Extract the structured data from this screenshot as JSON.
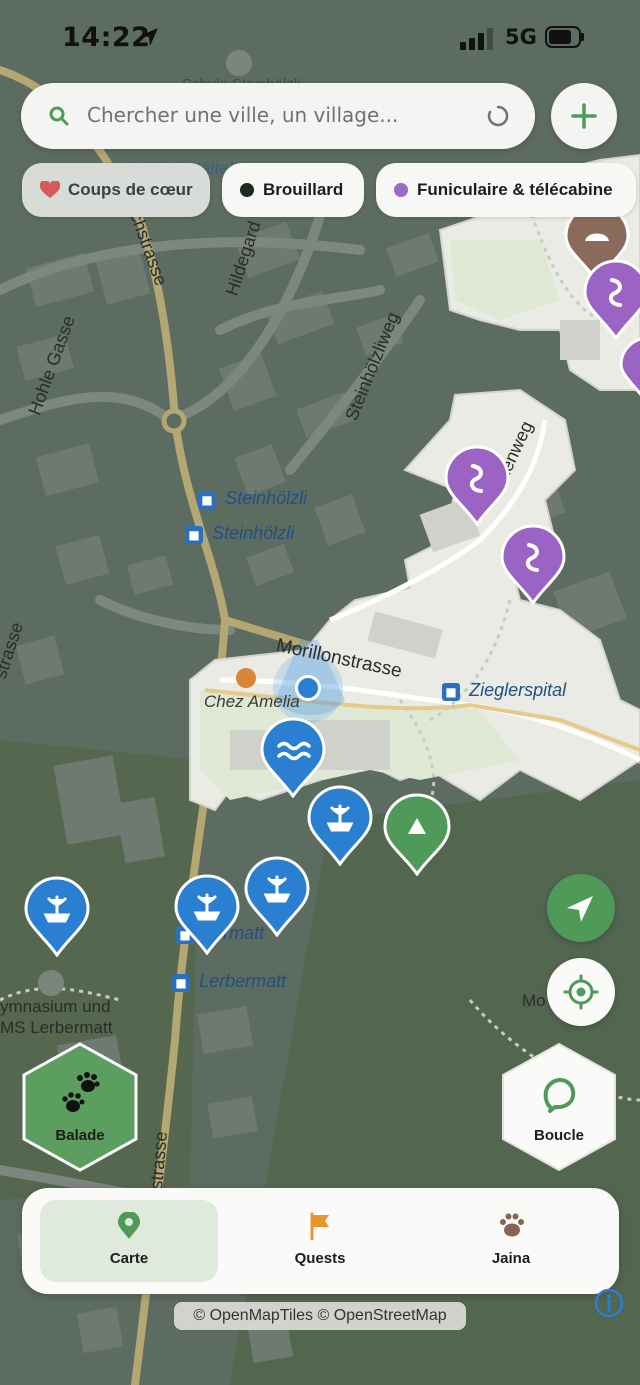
{
  "status_bar": {
    "time": "14:22",
    "network": "5G"
  },
  "search": {
    "placeholder": "Chercher une ville, un village..."
  },
  "filters": [
    {
      "label": "Coups de cœur",
      "color": "#d65a5a"
    },
    {
      "label": "Brouillard",
      "color": "#1d2a22"
    },
    {
      "label": "Funiculaire & télécabine",
      "color": "#9b6bc8"
    }
  ],
  "map": {
    "street_labels": [
      "Kirchstrasse",
      "Hohle Gasse",
      "Hildegard",
      "Steinhölzliweg",
      "Morillonstrasse",
      "strasse",
      "kenweg",
      "strasse"
    ],
    "stop_labels": [
      "Steinhölzli",
      "Steinhölzli",
      "Zieglerspital",
      "Lerbermatt",
      "bermatt"
    ],
    "place_labels": [
      "Chez Amelia",
      "Schule Steinhölzli",
      "Steinhölzli Mätteli",
      "ymnasium und",
      "MS Lerbermatt",
      "Mo"
    ],
    "colors": {
      "pin_blue": "#2b7fd0",
      "pin_purple": "#9a63c4",
      "pin_green": "#4f9a58",
      "pin_brown": "#8a6a5a",
      "accent_green": "#4f9a58"
    }
  },
  "actions": {
    "walk_label": "Balade",
    "loop_label": "Boucle"
  },
  "tabs": [
    {
      "label": "Carte",
      "icon": "map-pin-icon",
      "active": true
    },
    {
      "label": "Quests",
      "icon": "flag-icon",
      "active": false
    },
    {
      "label": "Jaina",
      "icon": "paw-icon",
      "active": false
    }
  ],
  "attribution": "© OpenMapTiles © OpenStreetMap"
}
